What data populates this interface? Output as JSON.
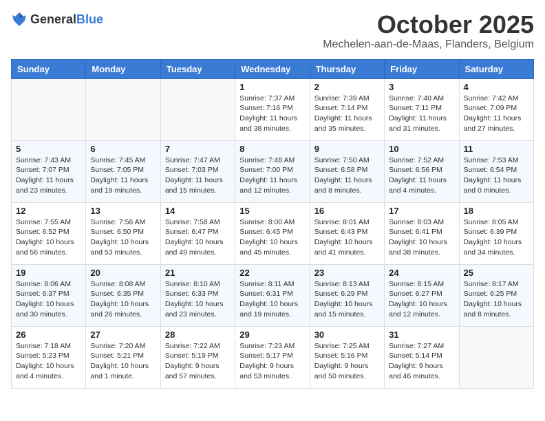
{
  "logo": {
    "general": "General",
    "blue": "Blue"
  },
  "header": {
    "month": "October 2025",
    "location": "Mechelen-aan-de-Maas, Flanders, Belgium"
  },
  "weekdays": [
    "Sunday",
    "Monday",
    "Tuesday",
    "Wednesday",
    "Thursday",
    "Friday",
    "Saturday"
  ],
  "weeks": [
    [
      {
        "day": "",
        "info": ""
      },
      {
        "day": "",
        "info": ""
      },
      {
        "day": "",
        "info": ""
      },
      {
        "day": "1",
        "info": "Sunrise: 7:37 AM\nSunset: 7:16 PM\nDaylight: 11 hours\nand 38 minutes."
      },
      {
        "day": "2",
        "info": "Sunrise: 7:39 AM\nSunset: 7:14 PM\nDaylight: 11 hours\nand 35 minutes."
      },
      {
        "day": "3",
        "info": "Sunrise: 7:40 AM\nSunset: 7:11 PM\nDaylight: 11 hours\nand 31 minutes."
      },
      {
        "day": "4",
        "info": "Sunrise: 7:42 AM\nSunset: 7:09 PM\nDaylight: 11 hours\nand 27 minutes."
      }
    ],
    [
      {
        "day": "5",
        "info": "Sunrise: 7:43 AM\nSunset: 7:07 PM\nDaylight: 11 hours\nand 23 minutes."
      },
      {
        "day": "6",
        "info": "Sunrise: 7:45 AM\nSunset: 7:05 PM\nDaylight: 11 hours\nand 19 minutes."
      },
      {
        "day": "7",
        "info": "Sunrise: 7:47 AM\nSunset: 7:03 PM\nDaylight: 11 hours\nand 15 minutes."
      },
      {
        "day": "8",
        "info": "Sunrise: 7:48 AM\nSunset: 7:00 PM\nDaylight: 11 hours\nand 12 minutes."
      },
      {
        "day": "9",
        "info": "Sunrise: 7:50 AM\nSunset: 6:58 PM\nDaylight: 11 hours\nand 8 minutes."
      },
      {
        "day": "10",
        "info": "Sunrise: 7:52 AM\nSunset: 6:56 PM\nDaylight: 11 hours\nand 4 minutes."
      },
      {
        "day": "11",
        "info": "Sunrise: 7:53 AM\nSunset: 6:54 PM\nDaylight: 11 hours\nand 0 minutes."
      }
    ],
    [
      {
        "day": "12",
        "info": "Sunrise: 7:55 AM\nSunset: 6:52 PM\nDaylight: 10 hours\nand 56 minutes."
      },
      {
        "day": "13",
        "info": "Sunrise: 7:56 AM\nSunset: 6:50 PM\nDaylight: 10 hours\nand 53 minutes."
      },
      {
        "day": "14",
        "info": "Sunrise: 7:58 AM\nSunset: 6:47 PM\nDaylight: 10 hours\nand 49 minutes."
      },
      {
        "day": "15",
        "info": "Sunrise: 8:00 AM\nSunset: 6:45 PM\nDaylight: 10 hours\nand 45 minutes."
      },
      {
        "day": "16",
        "info": "Sunrise: 8:01 AM\nSunset: 6:43 PM\nDaylight: 10 hours\nand 41 minutes."
      },
      {
        "day": "17",
        "info": "Sunrise: 8:03 AM\nSunset: 6:41 PM\nDaylight: 10 hours\nand 38 minutes."
      },
      {
        "day": "18",
        "info": "Sunrise: 8:05 AM\nSunset: 6:39 PM\nDaylight: 10 hours\nand 34 minutes."
      }
    ],
    [
      {
        "day": "19",
        "info": "Sunrise: 8:06 AM\nSunset: 6:37 PM\nDaylight: 10 hours\nand 30 minutes."
      },
      {
        "day": "20",
        "info": "Sunrise: 8:08 AM\nSunset: 6:35 PM\nDaylight: 10 hours\nand 26 minutes."
      },
      {
        "day": "21",
        "info": "Sunrise: 8:10 AM\nSunset: 6:33 PM\nDaylight: 10 hours\nand 23 minutes."
      },
      {
        "day": "22",
        "info": "Sunrise: 8:11 AM\nSunset: 6:31 PM\nDaylight: 10 hours\nand 19 minutes."
      },
      {
        "day": "23",
        "info": "Sunrise: 8:13 AM\nSunset: 6:29 PM\nDaylight: 10 hours\nand 15 minutes."
      },
      {
        "day": "24",
        "info": "Sunrise: 8:15 AM\nSunset: 6:27 PM\nDaylight: 10 hours\nand 12 minutes."
      },
      {
        "day": "25",
        "info": "Sunrise: 8:17 AM\nSunset: 6:25 PM\nDaylight: 10 hours\nand 8 minutes."
      }
    ],
    [
      {
        "day": "26",
        "info": "Sunrise: 7:18 AM\nSunset: 5:23 PM\nDaylight: 10 hours\nand 4 minutes."
      },
      {
        "day": "27",
        "info": "Sunrise: 7:20 AM\nSunset: 5:21 PM\nDaylight: 10 hours\nand 1 minute."
      },
      {
        "day": "28",
        "info": "Sunrise: 7:22 AM\nSunset: 5:19 PM\nDaylight: 9 hours\nand 57 minutes."
      },
      {
        "day": "29",
        "info": "Sunrise: 7:23 AM\nSunset: 5:17 PM\nDaylight: 9 hours\nand 53 minutes."
      },
      {
        "day": "30",
        "info": "Sunrise: 7:25 AM\nSunset: 5:16 PM\nDaylight: 9 hours\nand 50 minutes."
      },
      {
        "day": "31",
        "info": "Sunrise: 7:27 AM\nSunset: 5:14 PM\nDaylight: 9 hours\nand 46 minutes."
      },
      {
        "day": "",
        "info": ""
      }
    ]
  ]
}
